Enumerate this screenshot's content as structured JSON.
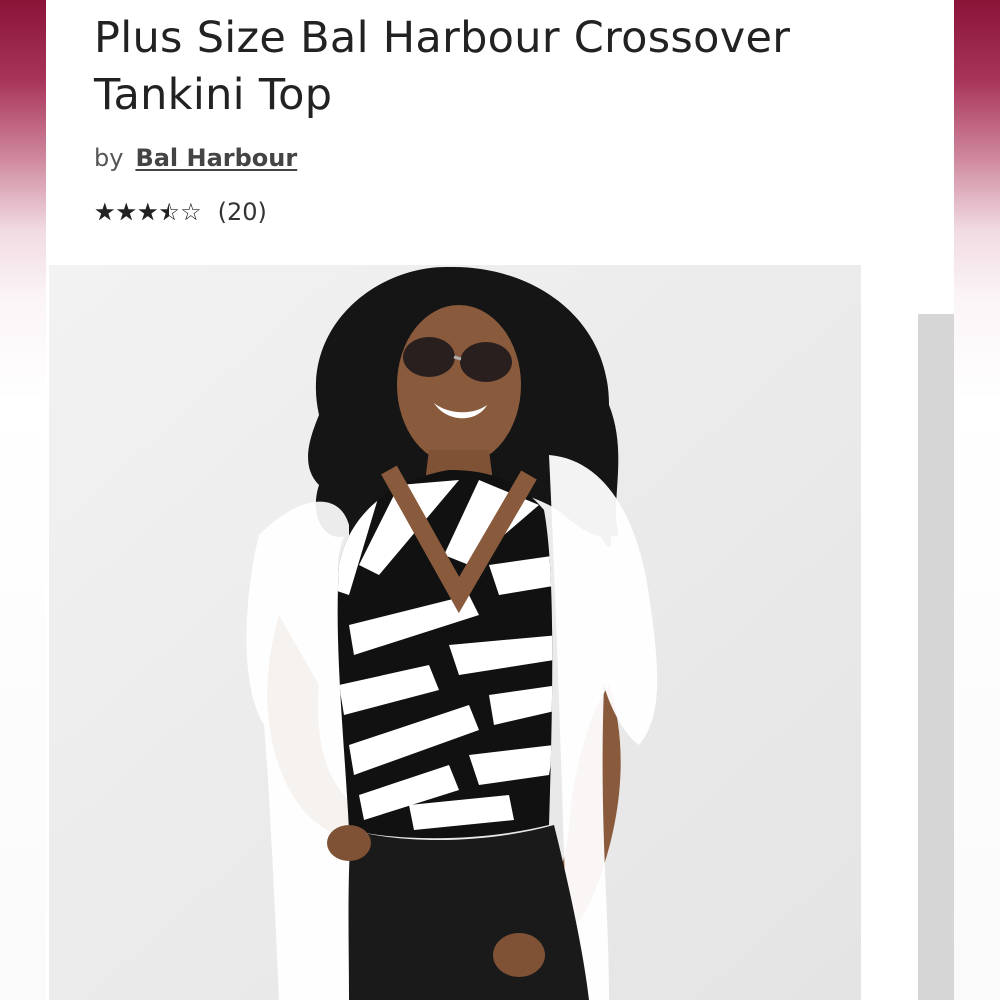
{
  "product": {
    "title": "Plus Size Bal Harbour Crossover Tankini Top",
    "by_label": "by",
    "brand": "Bal Harbour",
    "rating": 3.5,
    "rating_max": 5,
    "stars_text": "★★★★★",
    "empty_stars_text": "☆☆☆☆☆",
    "review_count": "(20)"
  },
  "image": {
    "alt": "Model wearing a black and white geometric print crossover tankini top with a white kimono cover-up, black swim skirt and sunglasses"
  },
  "colors": {
    "accent_top": "#8a1438",
    "text": "#222222",
    "scrollbar": "#d6d6d6"
  }
}
